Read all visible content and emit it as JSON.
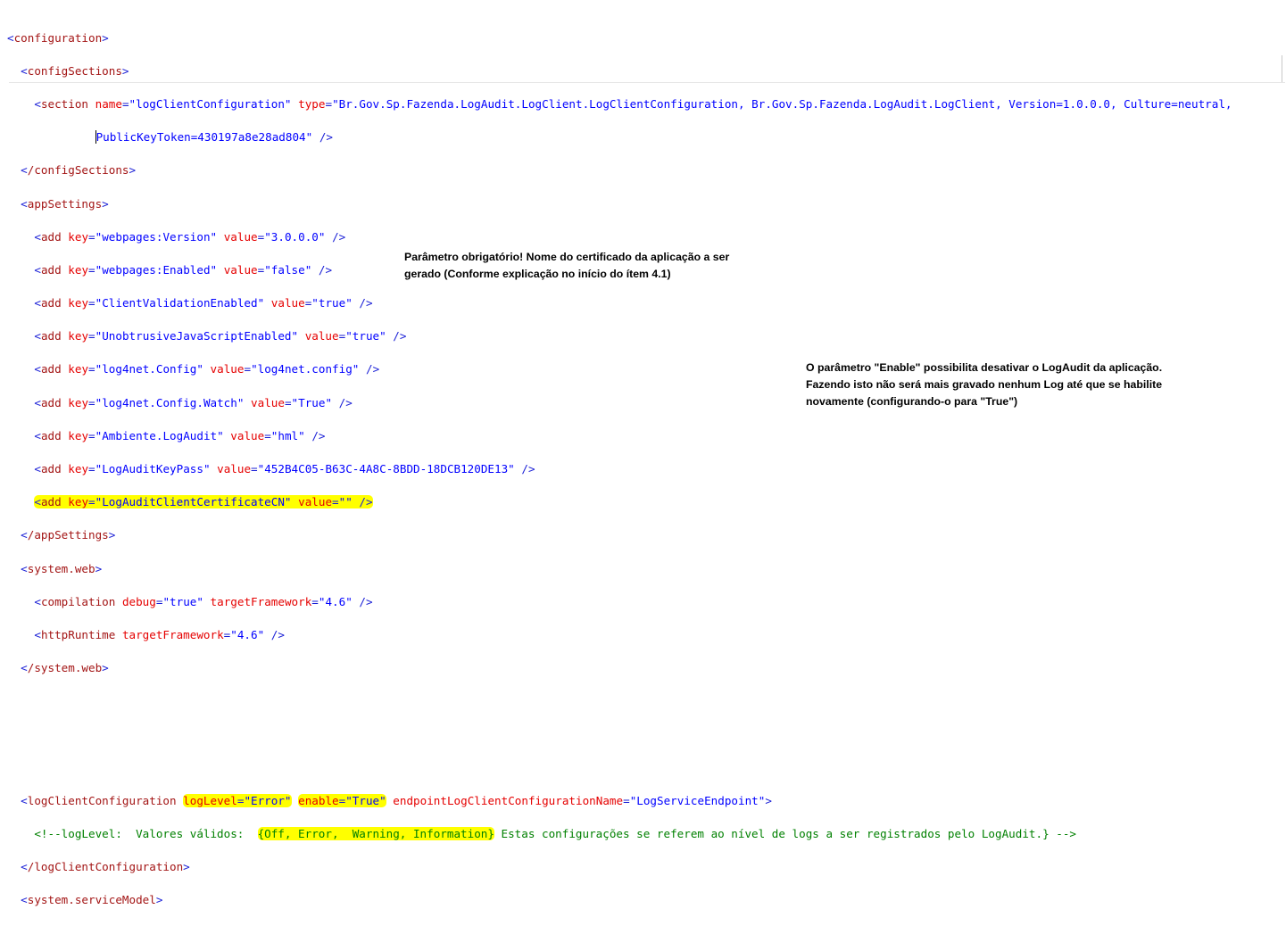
{
  "code": {
    "line1": "configuration",
    "line2": "configSections",
    "section": {
      "tag": "section",
      "attr_name": "name",
      "val_name": "\"logClientConfiguration\"",
      "attr_type": "type",
      "val_type": "\"Br.Gov.Sp.Fazenda.LogAudit.LogClient.LogClientConfiguration, Br.Gov.Sp.Fazenda.LogAudit.LogClient, Version=1.0.0.0, Culture=neutral,",
      "val_type_cont": "PublicKeyToken=430197a8e28ad804\""
    },
    "close_configSections": "/configSections",
    "appSettings": "appSettings",
    "add_items": [
      {
        "key": "\"webpages:Version\"",
        "value": "\"3.0.0.0\""
      },
      {
        "key": "\"webpages:Enabled\"",
        "value": "\"false\""
      },
      {
        "key": "\"ClientValidationEnabled\"",
        "value": "\"true\""
      },
      {
        "key": "\"UnobtrusiveJavaScriptEnabled\"",
        "value": "\"true\""
      },
      {
        "key": "\"log4net.Config\"",
        "value": "\"log4net.config\""
      },
      {
        "key": "\"log4net.Config.Watch\"",
        "value": "\"True\""
      },
      {
        "key": "\"Ambiente.LogAudit\"",
        "value": "\"hml\""
      },
      {
        "key": "\"LogAuditKeyPass\"",
        "value": "\"452B4C05-B63C-4A8C-8BDD-18DCB120DE13\""
      },
      {
        "key": "\"LogAuditClientCertificateCN\"",
        "value": "\"\""
      }
    ],
    "close_appSettings": "/appSettings",
    "system_web": "system.web",
    "compilation": {
      "tag": "compilation",
      "a1": "debug",
      "v1": "\"true\"",
      "a2": "targetFramework",
      "v2": "\"4.6\""
    },
    "httpRuntime": {
      "tag": "httpRuntime",
      "a1": "targetFramework",
      "v1": "\"4.6\""
    },
    "close_system_web": "/system.web",
    "logClient": {
      "tag": "logClientConfiguration",
      "a1": "logLevel",
      "v1": "\"Error\"",
      "a2": "enable",
      "v2": "\"True\"",
      "a3": "endpointLogClientConfigurationName",
      "v3": "\"LogServiceEndpoint\""
    },
    "comment_pre": "<!--logLevel:  Valores válidos:  ",
    "comment_hl": "{Off, Error,  Warning, Information}",
    "comment_post": " Estas configurações se referem ao nível de logs a ser registrados pelo LogAudit.} -->",
    "close_logClient": "/logClientConfiguration",
    "serviceModel": "system.serviceModel"
  },
  "notes": {
    "note1_line1": "Parâmetro obrigatório! Nome do certificado da aplicação a ser",
    "note1_line2": "gerado (Conforme explicação no início do ítem 4.1)",
    "note2_line1": "O parâmetro \"Enable\" possibilita desativar o LogAudit da aplicação.",
    "note2_line2": "Fazendo isto não será mais gravado nenhum Log até que se habilite",
    "note2_line3": "novamente (configurando-o para \"True\")"
  }
}
